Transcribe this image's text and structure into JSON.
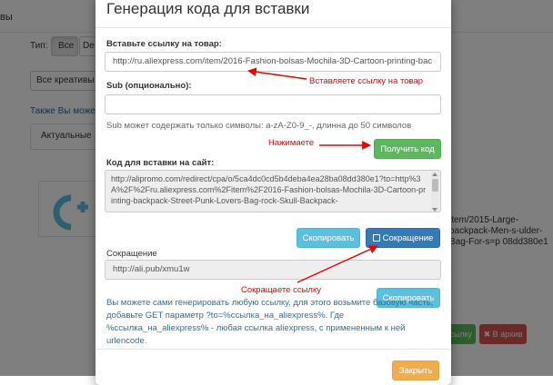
{
  "background": {
    "topbar_text": "вы",
    "type_label": "Тип:",
    "type_buttons": [
      "Все",
      "De"
    ],
    "select_value": "Все креативы",
    "also_link": "Также Вы можете",
    "tab_label": "Актуальные",
    "url_fragment": "item/2015-Large-backpack-Men-s-ulder-Bag-For-s=p 08dd380e1",
    "green_button": "ссылку",
    "red_button": "✖ В архив"
  },
  "modal": {
    "title": "Генерация кода для вставки",
    "url_label": "Вставьте ссылку на товар:",
    "url_value": "http://ru.aliexpress.com/item/2016-Fashion-bolsas-Mochila-3D-Cartoon-printing-bac",
    "sub_label": "Sub (опционально):",
    "sub_value": "",
    "sub_help": "Sub может содержать только символы: a-zA-Z0-9_-, длинна до 50 символов",
    "get_code_button": "Получить код",
    "code_label": "Код для вставки на сайт:",
    "code_value": "http://alipromo.com/redirect/cpa/o/5ca4dc0cd5b4deba4ea28ba08dd380e1?to=http%3A%2F%2Fru.aliexpress.com%2Fitem%2F2016-Fashion-bolsas-Mochila-3D-Cartoon-printing-backpack-Street-Punk-Lovers-Bag-rock-Skull-Backpack-",
    "copy_button": "Скопировать",
    "shorten_button": "Сокращение",
    "short_label": "Сокращение",
    "short_value": "http://ali.pub/xmu1w",
    "copy_button_2": "Скопировать",
    "info_text": "Вы можете сами генерировать любую ссылку, для этого возьмите базовую часть, добавьте GET параметр ?to=%ссылка_на_aliexpress%. Где %ссылка_на_aliexpress% - любая ссылка aliexpress, с примененным к ней urlencode.",
    "close_button": "Закрыть"
  },
  "annotations": {
    "insert_link": "Вставляете ссылку на товар",
    "click": "Нажимаете",
    "shorten": "Сокращаете ссылку"
  },
  "colors": {
    "annotation": "#e00000",
    "success": "#5cb85c",
    "info": "#5bc0de",
    "primary": "#337ab7",
    "warning": "#f0ad4e"
  }
}
